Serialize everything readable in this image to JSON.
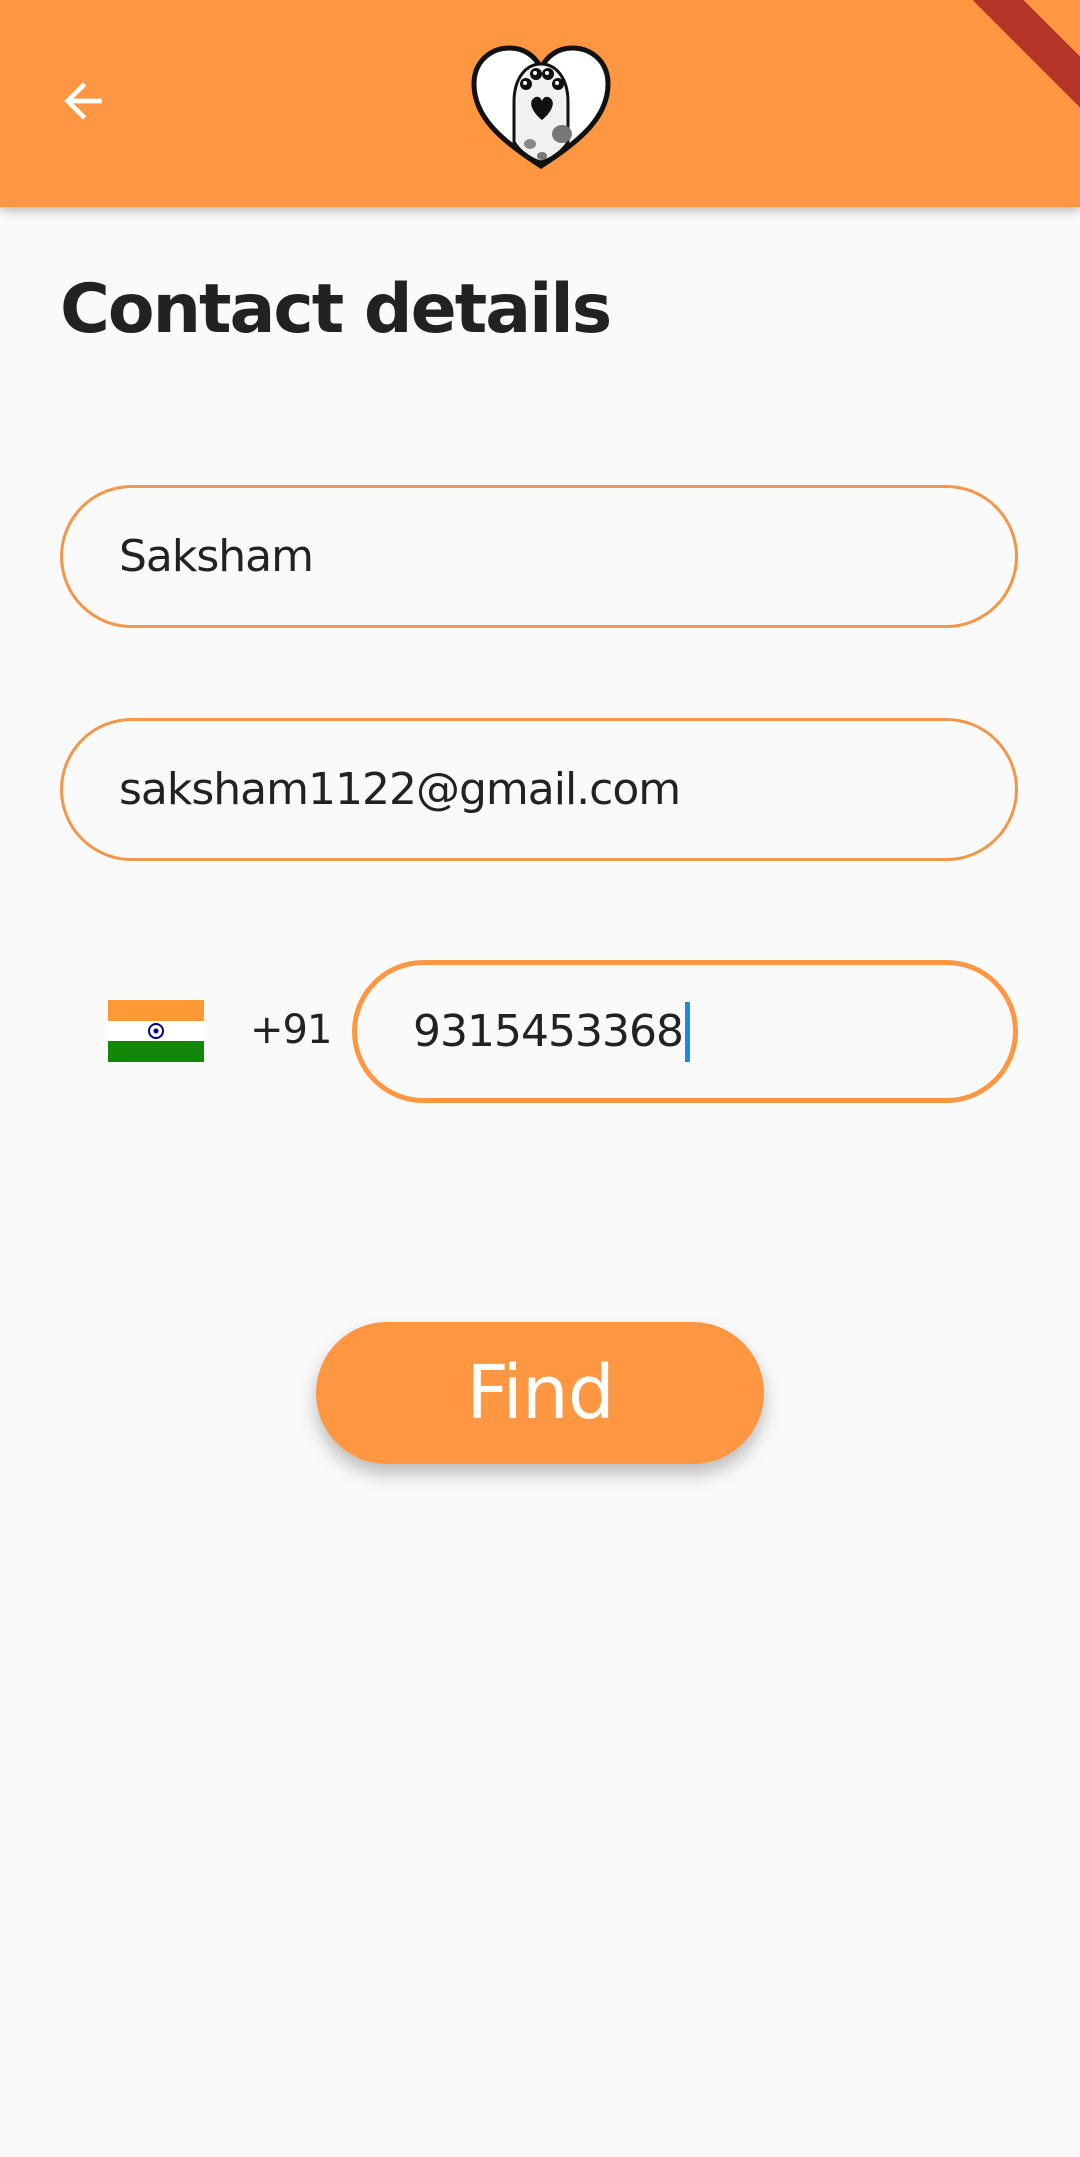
{
  "app_bar": {
    "back_icon": "arrow-left-icon",
    "logo_icon": "heart-paw-dog-icon",
    "color": "#ff9642"
  },
  "title": "Contact details",
  "form": {
    "name_value": "Saksham",
    "email_value": "saksham1122@gmail.com",
    "country_flag": "india-flag-icon",
    "dial_code": "+91",
    "phone_value": "9315453368"
  },
  "find_button": {
    "label": "Find"
  },
  "colors": {
    "accent": "#ff9642",
    "border": "#f2964a",
    "caret": "#1e88e5",
    "background": "#fafafa",
    "text": "#222222"
  }
}
